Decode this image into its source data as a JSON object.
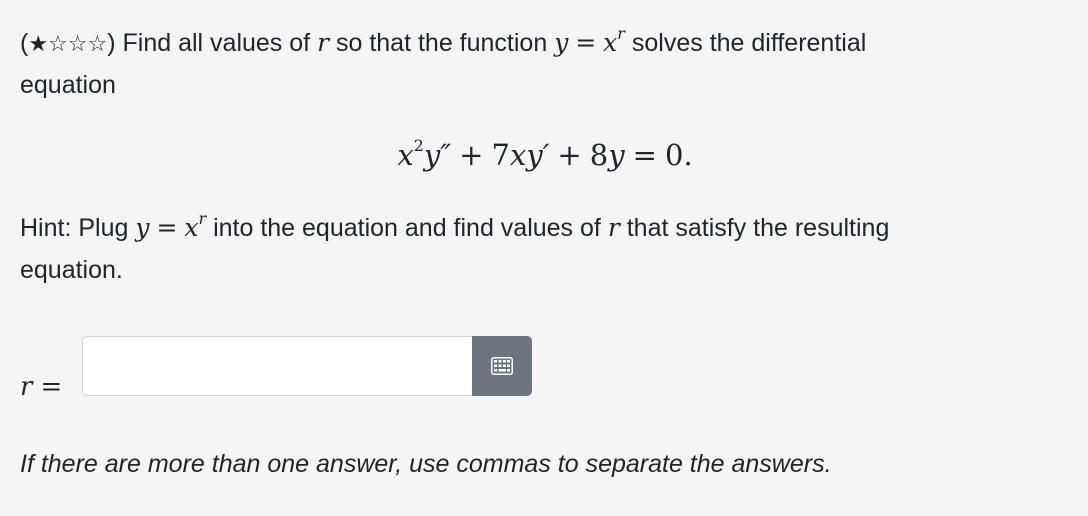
{
  "problem": {
    "difficulty_stars": "★☆☆☆",
    "line1_open_paren": "(",
    "line1_close_paren": ")",
    "line1_text_a": "Find all values of",
    "var_r": "r",
    "line1_text_b": "so that the function",
    "func_y": "y",
    "func_eq": "=",
    "func_x": "x",
    "func_exp": "r",
    "line1_text_c": "solves the differential",
    "line2_text": "equation"
  },
  "equation": {
    "x": "x",
    "x_exp": "2",
    "ypp": "y″",
    "plus1": "+",
    "coef1": "7",
    "xy": "xy′",
    "plus2": "+",
    "coef2": "8",
    "y": "y",
    "equals": "=",
    "rhs": "0."
  },
  "hint": {
    "label": "Hint:",
    "text_a": "Plug",
    "y": "y",
    "eq": "=",
    "x": "x",
    "x_exp": "r",
    "text_b": "into the equation and find values of",
    "r": "r",
    "text_c": "that satisfy the resulting",
    "line2": "equation."
  },
  "answer": {
    "variable": "r",
    "equals": "=",
    "value": "",
    "placeholder": "",
    "keypad_icon": "keypad-grid-icon",
    "keypad_icon_color": "#ffffff",
    "button_color": "#6c757d"
  },
  "note": "If there are more than one answer, use commas to separate the answers."
}
